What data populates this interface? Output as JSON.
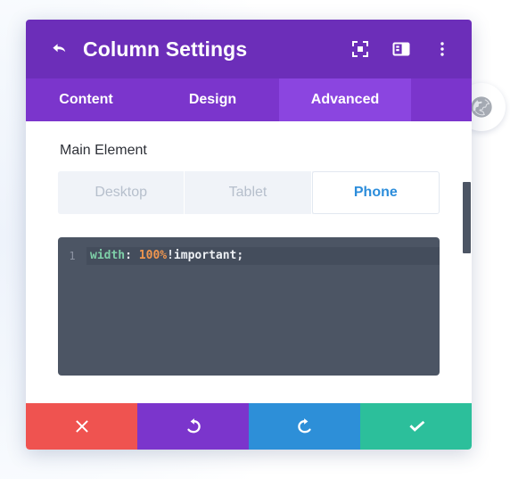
{
  "header": {
    "title": "Column Settings",
    "back_icon": "back-arrow-icon",
    "actions": [
      {
        "name": "focus-target-icon",
        "label": "Focus"
      },
      {
        "name": "layout-panel-icon",
        "label": "Layout"
      },
      {
        "name": "more-vertical-icon",
        "label": "More options"
      }
    ]
  },
  "tabs": [
    {
      "label": "Content",
      "active": false
    },
    {
      "label": "Design",
      "active": false
    },
    {
      "label": "Advanced",
      "active": true
    }
  ],
  "main": {
    "section_label": "Main Element",
    "device_toggle": {
      "options": [
        {
          "label": "Desktop",
          "active": false
        },
        {
          "label": "Tablet",
          "active": false
        },
        {
          "label": "Phone",
          "active": true
        }
      ]
    },
    "code_editor": {
      "line_numbers": [
        "1"
      ],
      "tokens": {
        "property": "width",
        "colon": ":",
        "value": "100%",
        "important": "!important",
        "semicolon": ";"
      },
      "full_text": "width: 100%!important;"
    }
  },
  "footer": {
    "buttons": [
      {
        "name": "cancel-button",
        "icon": "close-x-icon",
        "color": "#ef5350"
      },
      {
        "name": "undo-button",
        "icon": "undo-arrow-icon",
        "color": "#7b35cc"
      },
      {
        "name": "redo-button",
        "icon": "redo-arrow-icon",
        "color": "#2d8fd8"
      },
      {
        "name": "save-button",
        "icon": "checkmark-icon",
        "color": "#2cbf9b"
      }
    ]
  },
  "overlay": {
    "globe_badge_icon": "globe-icon"
  },
  "colors": {
    "header_purple": "#6c2eb9",
    "tab_bar_purple": "#7b35cc",
    "tab_active_purple": "#8b45e0",
    "active_blue": "#2c8ddb",
    "editor_bg": "#4c5564"
  }
}
